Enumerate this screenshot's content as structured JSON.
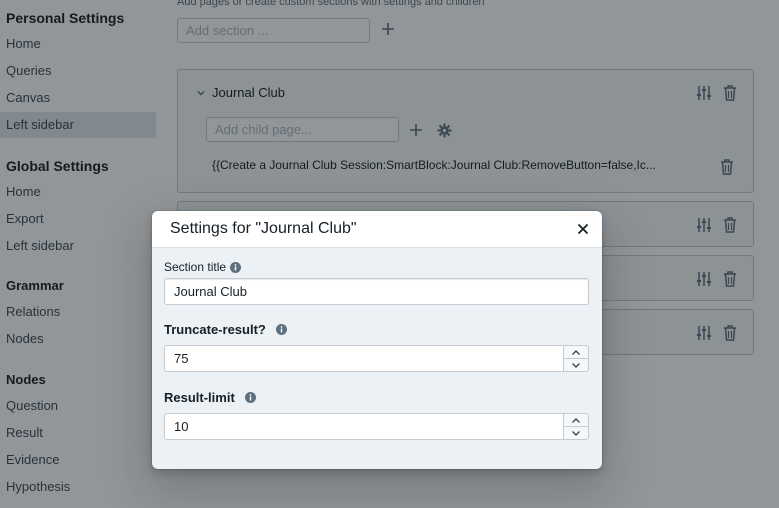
{
  "sidebar": {
    "personal_heading": "Personal Settings",
    "personal_items": [
      "Home",
      "Queries",
      "Canvas",
      "Left sidebar"
    ],
    "global_heading": "Global Settings",
    "global_items": [
      "Home",
      "Export",
      "Left sidebar"
    ],
    "grammar_heading": "Grammar",
    "grammar_items": [
      "Relations",
      "Nodes"
    ],
    "nodes_heading": "Nodes",
    "nodes_items": [
      "Question",
      "Result",
      "Evidence",
      "Hypothesis"
    ]
  },
  "main": {
    "help_text": "Add pages or create custom sections with settings and children",
    "add_section_placeholder": "Add section ...",
    "section": {
      "title": "Journal Club",
      "add_child_placeholder": "Add child page...",
      "child_text": "{{Create a Journal Club Session:SmartBlock:Journal Club:RemoveButton=false,Ic..."
    }
  },
  "dialog": {
    "title": "Settings for \"Journal Club\"",
    "section_title_label": "Section title",
    "section_title_value": "Journal Club",
    "truncate_label": "Truncate-result?",
    "truncate_value": "75",
    "limit_label": "Result-limit",
    "limit_value": "10"
  },
  "colors": {
    "overlay": "#10161a",
    "dialog_bg": "#ebf1f5",
    "active_sidebar_bg": "#e1e8ed"
  },
  "icons": [
    "chevron-down-icon",
    "sliders-icon",
    "trash-icon",
    "plus-icon",
    "gear-icon",
    "close-icon",
    "info-icon",
    "chevron-up-icon"
  ]
}
